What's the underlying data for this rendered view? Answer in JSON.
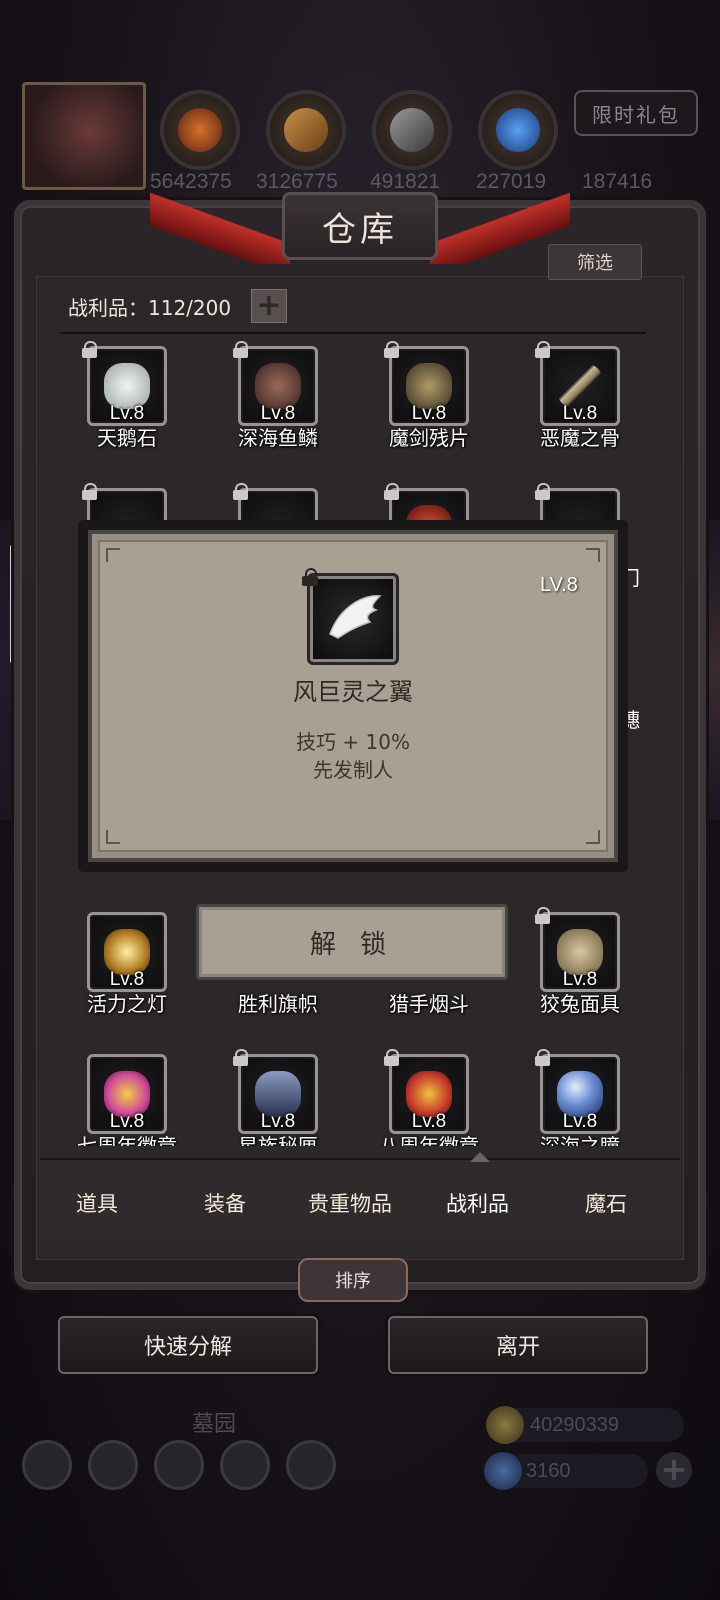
{
  "top_bar": {
    "resources": [
      {
        "name": "orange-resource-icon",
        "value": "5642375",
        "color": "#c05a24"
      },
      {
        "name": "wood-resource-icon",
        "value": "3126775",
        "color": "#b07a3a"
      },
      {
        "name": "iron-resource-icon",
        "value": "491821",
        "color": "#8a8a8c"
      },
      {
        "name": "crystal-resource-icon",
        "value": "227019",
        "color": "#3a7ad0"
      },
      {
        "name": "metal-resource-icon",
        "value": "187416",
        "color": "#6a6a6c"
      }
    ],
    "gift_label": "限时礼包"
  },
  "warehouse": {
    "title": "仓库",
    "filter_label": "筛选",
    "spoils_label": "战利品：112/200",
    "plus_label": "+"
  },
  "items": [
    {
      "name": "天鹅石",
      "level": "Lv.8",
      "color": "#d6dcdc"
    },
    {
      "name": "深海鱼鳞",
      "level": "Lv.8",
      "color": "#7a5048"
    },
    {
      "name": "魔剑残片",
      "level": "Lv.8",
      "color": "#8a7a5a"
    },
    {
      "name": "恶魔之骨",
      "level": "Lv.8",
      "color": "#b0a48a"
    },
    {
      "name": "活力之灯",
      "level": "Lv.8",
      "color": "#e0b040"
    },
    {
      "name": "胜利旗帜",
      "level": "",
      "color": "#555"
    },
    {
      "name": "猎手烟斗",
      "level": "",
      "color": "#555"
    },
    {
      "name": "狡兔面具",
      "level": "Lv.8",
      "color": "#b8a680"
    },
    {
      "name": "七周年徽章",
      "level": "Lv.8",
      "color": "#d04a9a"
    },
    {
      "name": "星族秘匣",
      "level": "Lv.8",
      "color": "#5a6a9a"
    },
    {
      "name": "八周年徽章",
      "level": "Lv.8",
      "color": "#c83a2a"
    },
    {
      "name": "深海之瞳",
      "level": "Lv.8",
      "color": "#6a8ad0"
    }
  ],
  "side_peek": {
    "right_top": "门",
    "right_mid": "穗"
  },
  "popup": {
    "level": "LV.8",
    "item_name": "风巨灵之翼",
    "stat": "技巧 + 10%",
    "effect": "先发制人",
    "unlock_label": "解 锁"
  },
  "tabs": [
    "道具",
    "装备",
    "贵重物品",
    "战利品",
    "魔石"
  ],
  "active_tab": "战利品",
  "sort_label": "排序",
  "quick_decompose_label": "快速分解",
  "leave_label": "离开",
  "location_label": "墓园",
  "currency": {
    "gold": "40290339",
    "gems": "3160"
  }
}
